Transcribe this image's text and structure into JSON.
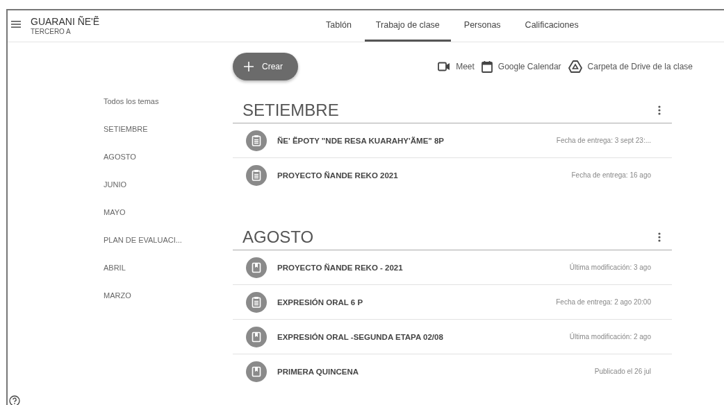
{
  "header": {
    "title": "GUARANI ÑE'Ẽ",
    "subtitle": "TERCERO A"
  },
  "tabs": [
    {
      "label": "Tablón",
      "selected": false
    },
    {
      "label": "Trabajo de clase",
      "selected": true
    },
    {
      "label": "Personas",
      "selected": false
    },
    {
      "label": "Calificaciones",
      "selected": false
    }
  ],
  "create_button": {
    "label": "Crear"
  },
  "links": [
    {
      "kind": "meet",
      "label": "Meet"
    },
    {
      "kind": "calendar",
      "label": "Google Calendar"
    },
    {
      "kind": "drive",
      "label": "Carpeta de Drive de la clase"
    }
  ],
  "topics": [
    "Todos los temas",
    "SETIEMBRE",
    "AGOSTO",
    "JUNIO",
    "MAYO",
    "PLAN DE EVALUACI...",
    "ABRIL",
    "MARZO"
  ],
  "sections": [
    {
      "title": "SETIEMBRE",
      "items": [
        {
          "kind": "assignment",
          "title": "ÑE' ẼPOTY \"NDE RESA KUARAHY'ÃME\" 8P",
          "meta": "Fecha de entrega: 3 sept 23:..."
        },
        {
          "kind": "assignment",
          "title": "PROYECTO ÑANDE REKO 2021",
          "meta": "Fecha de entrega: 16 ago"
        }
      ]
    },
    {
      "title": "AGOSTO",
      "items": [
        {
          "kind": "material",
          "title": "PROYECTO ÑANDE REKO - 2021",
          "meta": "Última modificación: 3 ago"
        },
        {
          "kind": "assignment",
          "title": "EXPRESIÓN ORAL 6 P",
          "meta": "Fecha de entrega: 2 ago 20:00"
        },
        {
          "kind": "material",
          "title": "EXPRESIÓN ORAL -SEGUNDA ETAPA 02/08",
          "meta": "Última modificación: 2 ago"
        },
        {
          "kind": "material",
          "title": "PRIMERA QUINCENA",
          "meta": "Publicado el 26 jul"
        }
      ]
    }
  ]
}
